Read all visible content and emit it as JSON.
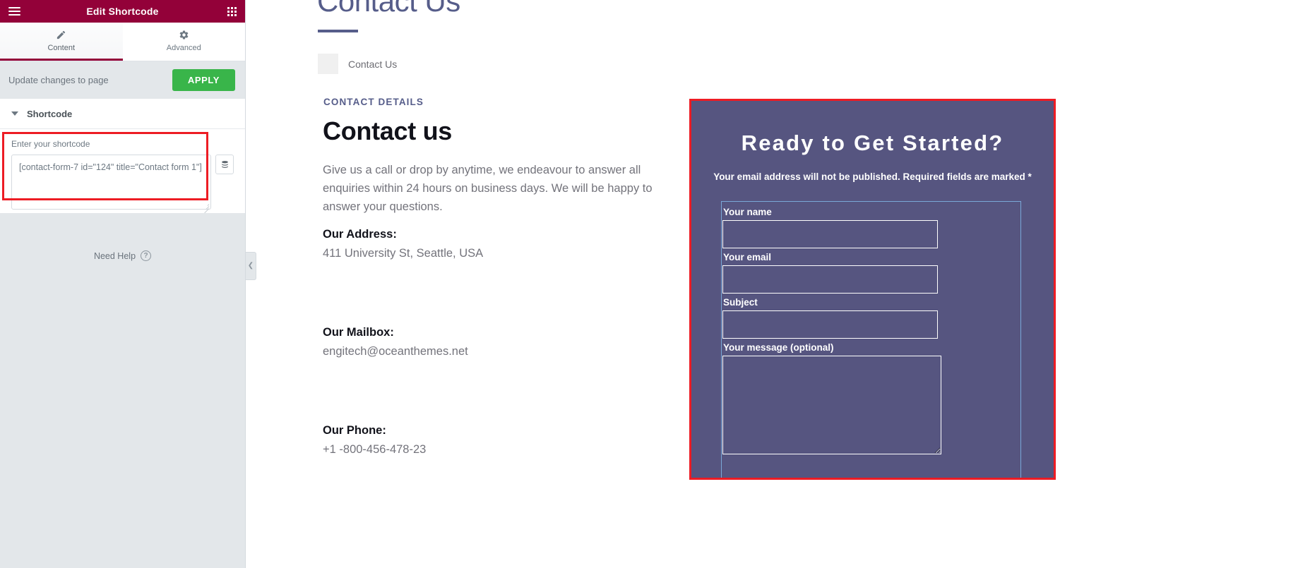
{
  "editor_panel": {
    "header": {
      "title": "Edit Shortcode",
      "menu_icon": "hamburger-icon",
      "grid_icon": "apps-grid-icon"
    },
    "tabs": [
      {
        "label": "Content",
        "icon": "pencil-icon",
        "active": true
      },
      {
        "label": "Advanced",
        "icon": "gear-icon",
        "active": false
      }
    ],
    "apply_bar": {
      "message": "Update changes to page",
      "button_label": "APPLY"
    },
    "section": {
      "title": "Shortcode",
      "collapse_icon": "caret-down-icon"
    },
    "shortcode_control": {
      "label": "Enter your shortcode",
      "value": "[contact-form-7 id=\"124\" title=\"Contact form 1\"]",
      "placeholder": "Enter your shortcode",
      "side_button_icon": "database-stack-icon",
      "highlight_color": "#ed1c24"
    },
    "footer": {
      "help_label": "Need Help",
      "help_icon": "question-circle-icon"
    },
    "collapse_handle_icon": "chevron-left-icon"
  },
  "preview": {
    "hero": {
      "title": "Contact Us",
      "accent_color": "#565d8a"
    },
    "breadcrumb": {
      "thumb_icon": "page-thumbnail",
      "text": "Contact Us"
    },
    "contact_section": {
      "eyebrow": "CONTACT DETAILS",
      "heading": "Contact us",
      "lede": "Give us a call or drop by anytime, we endeavour to answer all enquiries within 24 hours on business days. We will be happy to answer your questions.",
      "details": [
        {
          "label": "Our Address:",
          "value": "411 University St, Seattle, USA"
        },
        {
          "label": "Our Mailbox:",
          "value": "engitech@oceanthemes.net"
        },
        {
          "label": "Our Phone:",
          "value": "+1 -800-456-478-23"
        }
      ]
    },
    "cta": {
      "heading": "Ready to Get Started?",
      "subheading": "Your email address will not be published. Required fields are marked *",
      "background_color": "#565580",
      "selection_border_color": "#ed1c24",
      "form_outline_color": "#7aa8d8",
      "fields": [
        {
          "label": "Your name",
          "type": "text",
          "value": ""
        },
        {
          "label": "Your email",
          "type": "text",
          "value": ""
        },
        {
          "label": "Subject",
          "type": "text",
          "value": ""
        },
        {
          "label": "Your message (optional)",
          "type": "textarea",
          "value": ""
        }
      ]
    }
  }
}
